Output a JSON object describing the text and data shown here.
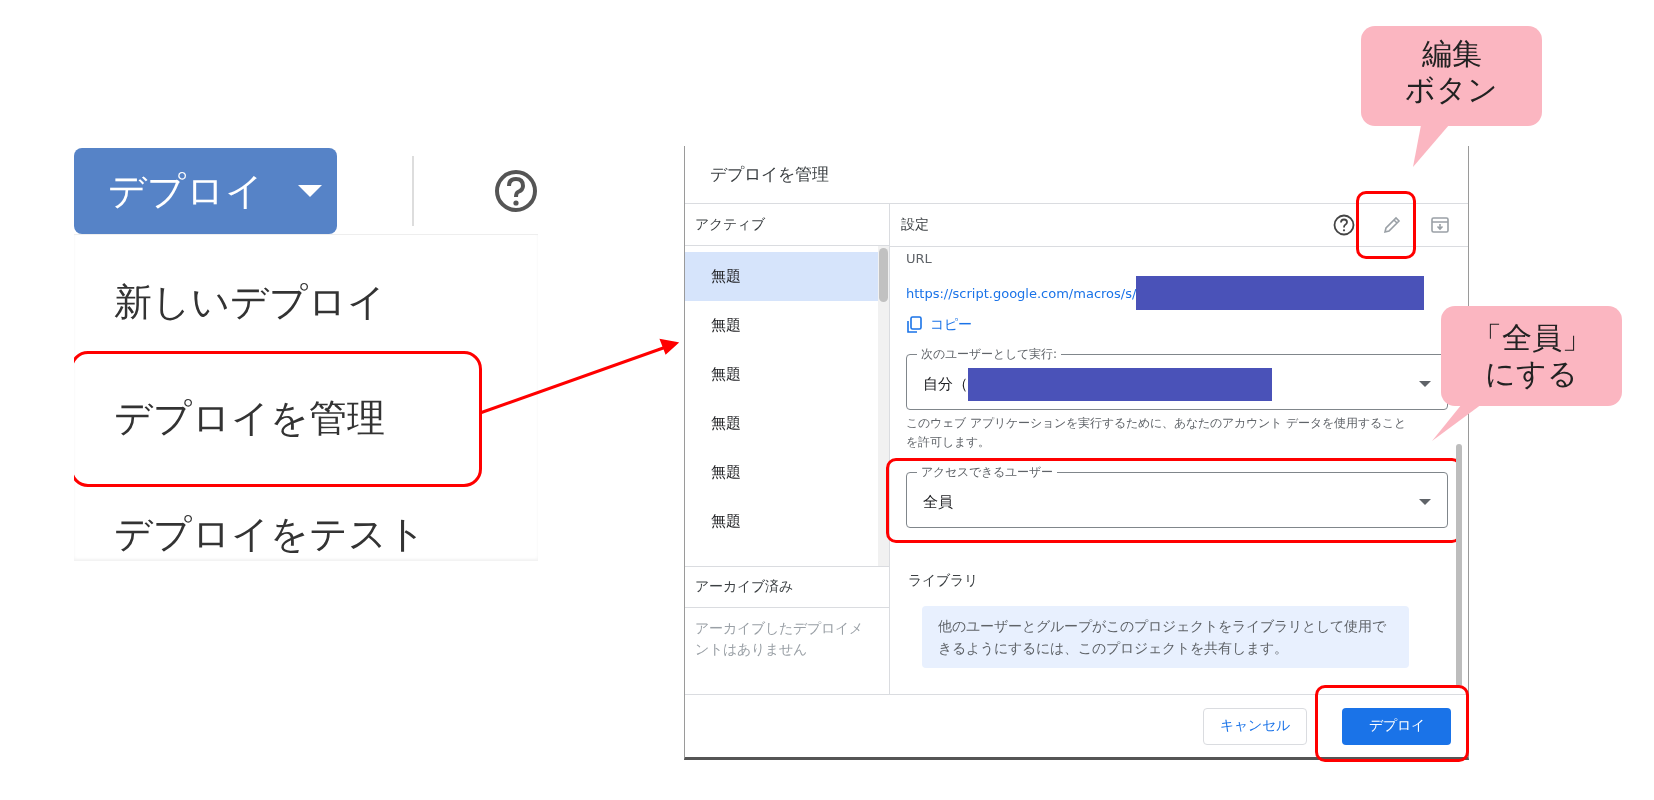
{
  "toolbar": {
    "deploy_button": "デプロイ"
  },
  "deploy_menu": [
    {
      "label": "新しいデプロイ",
      "highlighted": false
    },
    {
      "label": "デプロイを管理",
      "highlighted": true
    },
    {
      "label": "デプロイをテスト",
      "highlighted": false
    }
  ],
  "dialog": {
    "title": "デプロイを管理",
    "active_header": "アクティブ",
    "deployments": [
      {
        "label": "無題",
        "selected": true
      },
      {
        "label": "無題",
        "selected": false
      },
      {
        "label": "無題",
        "selected": false
      },
      {
        "label": "無題",
        "selected": false
      },
      {
        "label": "無題",
        "selected": false
      },
      {
        "label": "無題",
        "selected": false
      }
    ],
    "archived_header": "アーカイブ済み",
    "archived_empty": "アーカイブしたデプロイメントはありません",
    "settings_header": "設定",
    "edit_highlighted": true,
    "url_label": "URL",
    "url": "https://script.google.com/macros/s/",
    "copy": "コピー",
    "fields": [
      {
        "label": "次のユーザーとして実行:",
        "value": "自分（",
        "redacted": true,
        "highlighted": false,
        "help": "このウェブ アプリケーションを実行するために、あなたのアカウント データを使用することを許可します。"
      },
      {
        "label": "アクセスできるユーザー",
        "value": "全員",
        "redacted": false,
        "highlighted": true
      }
    ],
    "library_header": "ライブラリ",
    "library_info": "他のユーザーとグループがこのプロジェクトをライブラリとして使用できるようにするには、このプロジェクトを共有します。",
    "buttons": [
      {
        "label": "キャンセル",
        "kind": "secondary",
        "highlighted": false
      },
      {
        "label": "デプロイ",
        "kind": "primary",
        "highlighted": true
      }
    ]
  },
  "callouts": [
    {
      "lines": [
        "編集",
        "ボタン"
      ]
    },
    {
      "lines": [
        "「全員」",
        "にする"
      ]
    }
  ]
}
